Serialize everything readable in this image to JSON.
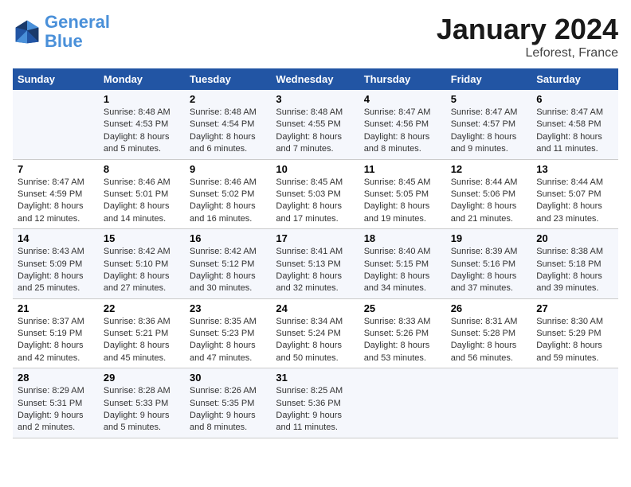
{
  "logo": {
    "line1": "General",
    "line2": "Blue"
  },
  "title": "January 2024",
  "location": "Leforest, France",
  "headers": [
    "Sunday",
    "Monday",
    "Tuesday",
    "Wednesday",
    "Thursday",
    "Friday",
    "Saturday"
  ],
  "weeks": [
    [
      {
        "day": "",
        "info": ""
      },
      {
        "day": "1",
        "sunrise": "Sunrise: 8:48 AM",
        "sunset": "Sunset: 4:53 PM",
        "daylight": "Daylight: 8 hours and 5 minutes."
      },
      {
        "day": "2",
        "sunrise": "Sunrise: 8:48 AM",
        "sunset": "Sunset: 4:54 PM",
        "daylight": "Daylight: 8 hours and 6 minutes."
      },
      {
        "day": "3",
        "sunrise": "Sunrise: 8:48 AM",
        "sunset": "Sunset: 4:55 PM",
        "daylight": "Daylight: 8 hours and 7 minutes."
      },
      {
        "day": "4",
        "sunrise": "Sunrise: 8:47 AM",
        "sunset": "Sunset: 4:56 PM",
        "daylight": "Daylight: 8 hours and 8 minutes."
      },
      {
        "day": "5",
        "sunrise": "Sunrise: 8:47 AM",
        "sunset": "Sunset: 4:57 PM",
        "daylight": "Daylight: 8 hours and 9 minutes."
      },
      {
        "day": "6",
        "sunrise": "Sunrise: 8:47 AM",
        "sunset": "Sunset: 4:58 PM",
        "daylight": "Daylight: 8 hours and 11 minutes."
      }
    ],
    [
      {
        "day": "7",
        "sunrise": "Sunrise: 8:47 AM",
        "sunset": "Sunset: 4:59 PM",
        "daylight": "Daylight: 8 hours and 12 minutes."
      },
      {
        "day": "8",
        "sunrise": "Sunrise: 8:46 AM",
        "sunset": "Sunset: 5:01 PM",
        "daylight": "Daylight: 8 hours and 14 minutes."
      },
      {
        "day": "9",
        "sunrise": "Sunrise: 8:46 AM",
        "sunset": "Sunset: 5:02 PM",
        "daylight": "Daylight: 8 hours and 16 minutes."
      },
      {
        "day": "10",
        "sunrise": "Sunrise: 8:45 AM",
        "sunset": "Sunset: 5:03 PM",
        "daylight": "Daylight: 8 hours and 17 minutes."
      },
      {
        "day": "11",
        "sunrise": "Sunrise: 8:45 AM",
        "sunset": "Sunset: 5:05 PM",
        "daylight": "Daylight: 8 hours and 19 minutes."
      },
      {
        "day": "12",
        "sunrise": "Sunrise: 8:44 AM",
        "sunset": "Sunset: 5:06 PM",
        "daylight": "Daylight: 8 hours and 21 minutes."
      },
      {
        "day": "13",
        "sunrise": "Sunrise: 8:44 AM",
        "sunset": "Sunset: 5:07 PM",
        "daylight": "Daylight: 8 hours and 23 minutes."
      }
    ],
    [
      {
        "day": "14",
        "sunrise": "Sunrise: 8:43 AM",
        "sunset": "Sunset: 5:09 PM",
        "daylight": "Daylight: 8 hours and 25 minutes."
      },
      {
        "day": "15",
        "sunrise": "Sunrise: 8:42 AM",
        "sunset": "Sunset: 5:10 PM",
        "daylight": "Daylight: 8 hours and 27 minutes."
      },
      {
        "day": "16",
        "sunrise": "Sunrise: 8:42 AM",
        "sunset": "Sunset: 5:12 PM",
        "daylight": "Daylight: 8 hours and 30 minutes."
      },
      {
        "day": "17",
        "sunrise": "Sunrise: 8:41 AM",
        "sunset": "Sunset: 5:13 PM",
        "daylight": "Daylight: 8 hours and 32 minutes."
      },
      {
        "day": "18",
        "sunrise": "Sunrise: 8:40 AM",
        "sunset": "Sunset: 5:15 PM",
        "daylight": "Daylight: 8 hours and 34 minutes."
      },
      {
        "day": "19",
        "sunrise": "Sunrise: 8:39 AM",
        "sunset": "Sunset: 5:16 PM",
        "daylight": "Daylight: 8 hours and 37 minutes."
      },
      {
        "day": "20",
        "sunrise": "Sunrise: 8:38 AM",
        "sunset": "Sunset: 5:18 PM",
        "daylight": "Daylight: 8 hours and 39 minutes."
      }
    ],
    [
      {
        "day": "21",
        "sunrise": "Sunrise: 8:37 AM",
        "sunset": "Sunset: 5:19 PM",
        "daylight": "Daylight: 8 hours and 42 minutes."
      },
      {
        "day": "22",
        "sunrise": "Sunrise: 8:36 AM",
        "sunset": "Sunset: 5:21 PM",
        "daylight": "Daylight: 8 hours and 45 minutes."
      },
      {
        "day": "23",
        "sunrise": "Sunrise: 8:35 AM",
        "sunset": "Sunset: 5:23 PM",
        "daylight": "Daylight: 8 hours and 47 minutes."
      },
      {
        "day": "24",
        "sunrise": "Sunrise: 8:34 AM",
        "sunset": "Sunset: 5:24 PM",
        "daylight": "Daylight: 8 hours and 50 minutes."
      },
      {
        "day": "25",
        "sunrise": "Sunrise: 8:33 AM",
        "sunset": "Sunset: 5:26 PM",
        "daylight": "Daylight: 8 hours and 53 minutes."
      },
      {
        "day": "26",
        "sunrise": "Sunrise: 8:31 AM",
        "sunset": "Sunset: 5:28 PM",
        "daylight": "Daylight: 8 hours and 56 minutes."
      },
      {
        "day": "27",
        "sunrise": "Sunrise: 8:30 AM",
        "sunset": "Sunset: 5:29 PM",
        "daylight": "Daylight: 8 hours and 59 minutes."
      }
    ],
    [
      {
        "day": "28",
        "sunrise": "Sunrise: 8:29 AM",
        "sunset": "Sunset: 5:31 PM",
        "daylight": "Daylight: 9 hours and 2 minutes."
      },
      {
        "day": "29",
        "sunrise": "Sunrise: 8:28 AM",
        "sunset": "Sunset: 5:33 PM",
        "daylight": "Daylight: 9 hours and 5 minutes."
      },
      {
        "day": "30",
        "sunrise": "Sunrise: 8:26 AM",
        "sunset": "Sunset: 5:35 PM",
        "daylight": "Daylight: 9 hours and 8 minutes."
      },
      {
        "day": "31",
        "sunrise": "Sunrise: 8:25 AM",
        "sunset": "Sunset: 5:36 PM",
        "daylight": "Daylight: 9 hours and 11 minutes."
      },
      {
        "day": "",
        "info": ""
      },
      {
        "day": "",
        "info": ""
      },
      {
        "day": "",
        "info": ""
      }
    ]
  ]
}
